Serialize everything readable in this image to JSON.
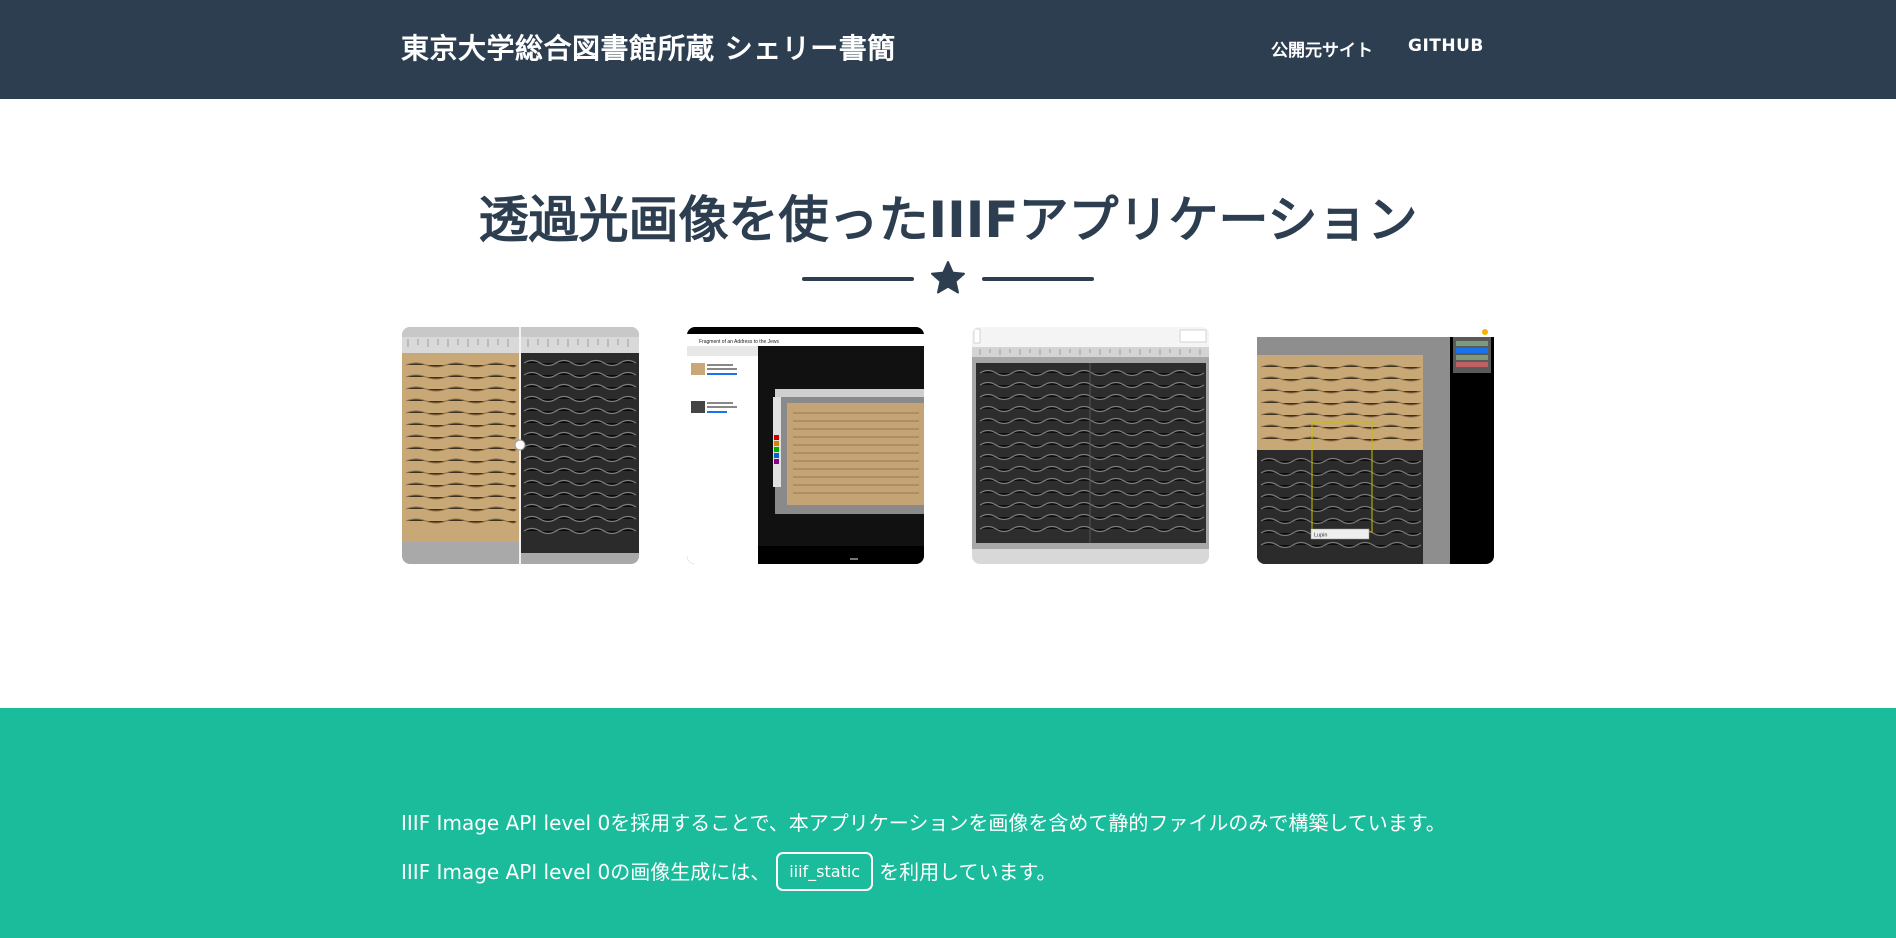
{
  "navbar": {
    "brand": "東京大学総合図書館所蔵 シェリー書簡",
    "links": [
      "公開元サイト",
      "GITHUB"
    ]
  },
  "portfolio": {
    "title": "透過光画像を使ったIIIFアプリケーション",
    "thumbnails": [
      {
        "icon": "image-comparison-slider"
      },
      {
        "icon": "layered-image-viewer",
        "caption": "Fragment of an Address to the Jews"
      },
      {
        "icon": "transmitted-light-viewer"
      },
      {
        "icon": "image-annotation-viewer",
        "annotation": "Lupin"
      }
    ]
  },
  "about": {
    "line1": "IIIF Image API level 0を採用することで、本アプリケーションを画像を含めて静的ファイルのみで構築しています。",
    "line2_before": "IIIF Image API level 0の画像生成には、",
    "line2_button": "iiif_static",
    "line2_after": "を利用しています。"
  },
  "colors": {
    "navbar": "#2c3e50",
    "accent": "#1abc9c",
    "text": "#2c3e50"
  }
}
